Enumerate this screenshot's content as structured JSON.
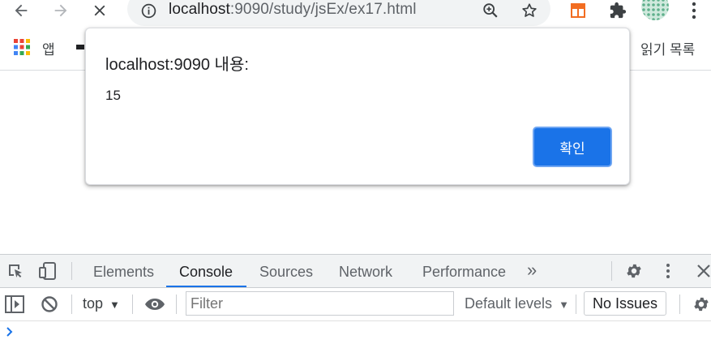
{
  "browser": {
    "url_host": "localhost",
    "url_path": ":9090/study/jsEx/ex17.html",
    "icons": [
      "back-icon",
      "forward-icon",
      "stop-icon",
      "info-icon",
      "zoom-icon",
      "star-icon",
      "extension-icon",
      "puzzle-icon",
      "avatar",
      "more-icon"
    ]
  },
  "bookmarks": {
    "apps_label": "앱",
    "reading_list_label": "읽기 목록"
  },
  "dialog": {
    "title": "localhost:9090 내용:",
    "message": "15",
    "ok_label": "확인"
  },
  "devtools": {
    "tabs": [
      {
        "label": "Elements"
      },
      {
        "label": "Console",
        "active": true
      },
      {
        "label": "Sources"
      },
      {
        "label": "Network"
      },
      {
        "label": "Performance"
      }
    ],
    "more_tabs": "»",
    "context": "top",
    "filter_placeholder": "Filter",
    "levels": "Default levels",
    "issues": "No Issues"
  },
  "colors": {
    "accent": "#1a73e8",
    "toolbar_bg": "#ffffff",
    "devtools_tab_bg": "#f1f3f4"
  }
}
